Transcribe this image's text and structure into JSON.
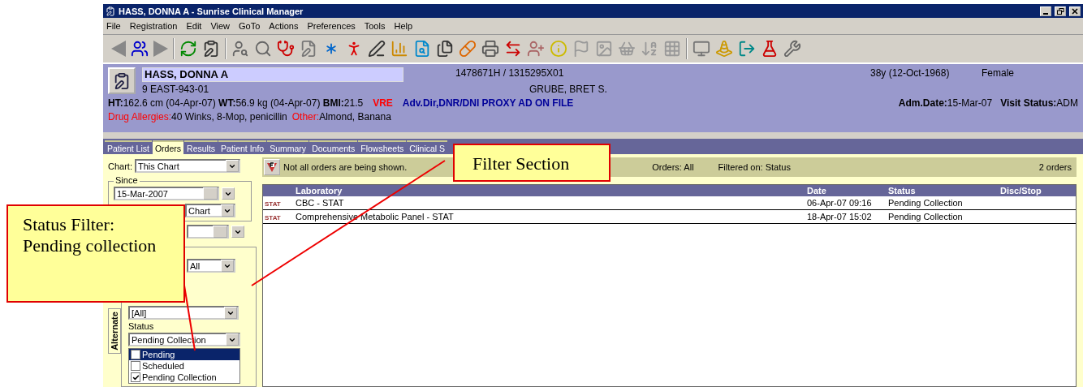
{
  "window": {
    "title": "HASS, DONNA A - Sunrise Clinical Manager"
  },
  "menu": [
    "File",
    "Registration",
    "Edit",
    "View",
    "GoTo",
    "Actions",
    "Preferences",
    "Tools",
    "Help"
  ],
  "patient": {
    "name": "HASS, DONNA A",
    "location": "9 EAST-943-01",
    "ids": "1478671H / 1315295X01",
    "physician": "GRUBE, BRET S.",
    "age": "38y (12-Oct-1968)",
    "sex": "Female",
    "vitals": "**HT:**162.6 cm  (04-Apr-07) **WT:**56.9 kg  (04-Apr-07) **BMI:**21.5",
    "alerts": [
      {
        "text": "VRE",
        "color": "#ff0000"
      },
      {
        "text": "Adv.Dir,DNR/DNI PROXY AD ON FILE",
        "color": "#000099"
      }
    ],
    "admission": [
      {
        "label": "Adm.Date:",
        "value": "15-Mar-07"
      },
      {
        "label": "Visit Status:",
        "value": "ADM"
      }
    ],
    "allergies": [
      {
        "label": "Drug Allergies:",
        "value": "40 Winks, 8-Mop, penicillin"
      },
      {
        "label": "Other:",
        "value": "Almond, Banana"
      }
    ]
  },
  "tabs": [
    {
      "label": "Patient List",
      "selected": false
    },
    {
      "label": "Orders",
      "selected": true
    },
    {
      "label": "Results",
      "selected": false
    },
    {
      "label": "Patient Info",
      "selected": false
    },
    {
      "label": "Summary",
      "selected": false
    },
    {
      "label": "Documents",
      "selected": false
    },
    {
      "label": "Flowsheets",
      "selected": false
    },
    {
      "label": "Clinical S",
      "selected": false
    }
  ],
  "filters": {
    "chart_label": "Chart:",
    "chart_value": "This Chart",
    "since_label": "Since",
    "since_date": "15-Mar-2007",
    "since_type": "Chart",
    "ordered_value": "All",
    "type_value": "[All]",
    "status_label": "Status",
    "status_value": "Pending Collection",
    "side_tab": "Alternate",
    "status_options": [
      {
        "label": "Pending",
        "checked": false,
        "selected": true
      },
      {
        "label": "Scheduled",
        "checked": false,
        "selected": false
      },
      {
        "label": "Pending Collection",
        "checked": true,
        "selected": false
      }
    ]
  },
  "filter_bar": {
    "message": "Not all orders are being shown.",
    "orders": "Orders: All",
    "filtered": "Filtered on: Status",
    "count": "2 orders"
  },
  "table": {
    "columns": [
      "Laboratory",
      "Date",
      "Status",
      "Disc/Stop"
    ],
    "rows": [
      {
        "badge": "STAT",
        "cells": [
          "CBC - STAT",
          "06-Apr-07 09:16",
          "Pending Collection",
          ""
        ]
      },
      {
        "badge": "STAT",
        "cells": [
          "Comprehensive Metabolic Panel - STAT",
          "18-Apr-07 15:02",
          "Pending Collection",
          ""
        ]
      }
    ]
  },
  "callouts": [
    {
      "text": "Status Filter: Pending collection"
    },
    {
      "text": "Filter Section"
    }
  ]
}
